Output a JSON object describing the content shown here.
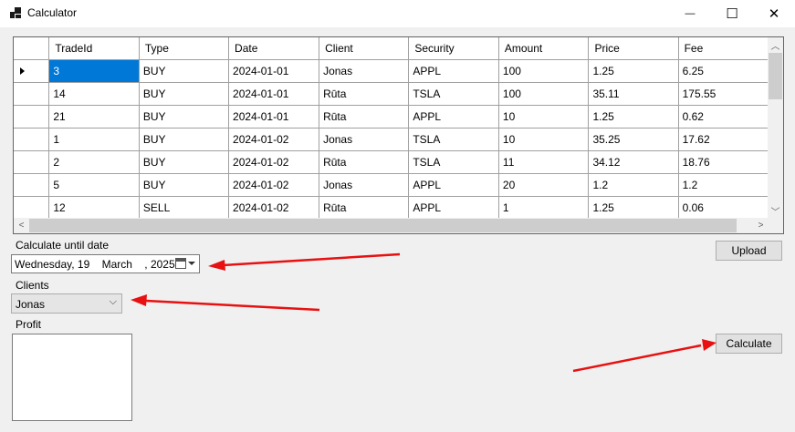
{
  "window": {
    "title": "Calculator",
    "minimize_glyph": "—",
    "maximize_glyph": "☐",
    "close_glyph": "✕"
  },
  "grid": {
    "columns": [
      "TradeId",
      "Type",
      "Date",
      "Client",
      "Security",
      "Amount",
      "Price",
      "Fee"
    ],
    "rows": [
      [
        "3",
        "BUY",
        "2024-01-01",
        "Jonas",
        "APPL",
        "100",
        "1.25",
        "6.25"
      ],
      [
        "14",
        "BUY",
        "2024-01-01",
        "Rūta",
        "TSLA",
        "100",
        "35.11",
        "175.55"
      ],
      [
        "21",
        "BUY",
        "2024-01-01",
        "Rūta",
        "APPL",
        "10",
        "1.25",
        "0.62"
      ],
      [
        "1",
        "BUY",
        "2024-01-02",
        "Jonas",
        "TSLA",
        "10",
        "35.25",
        "17.62"
      ],
      [
        "2",
        "BUY",
        "2024-01-02",
        "Rūta",
        "TSLA",
        "11",
        "34.12",
        "18.76"
      ],
      [
        "5",
        "BUY",
        "2024-01-02",
        "Jonas",
        "APPL",
        "20",
        "1.2",
        "1.2"
      ],
      [
        "12",
        "SELL",
        "2024-01-02",
        "Rūta",
        "APPL",
        "1",
        "1.25",
        "0.06"
      ]
    ],
    "selected_row": 0
  },
  "form": {
    "date_label": "Calculate until date",
    "date_value": "Wednesday, 19    March    , 2025",
    "clients_label": "Clients",
    "clients_value": "Jonas",
    "profit_label": "Profit",
    "upload_button": "Upload",
    "calculate_button": "Calculate"
  },
  "colors": {
    "selection": "#0078d7",
    "annotation_arrow": "#e81010"
  }
}
